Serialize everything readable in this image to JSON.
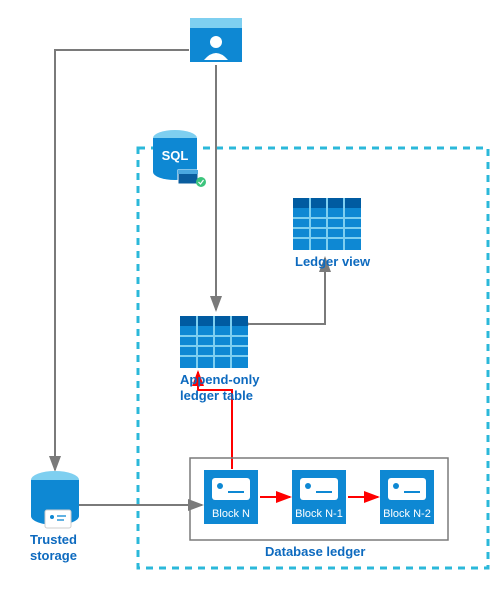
{
  "labels": {
    "sql": "SQL",
    "ledger_view": "Ledger view",
    "append_table": "Append-only\nledger table",
    "trusted_storage": "Trusted\nstorage",
    "database_ledger": "Database ledger",
    "block_n": "Block N",
    "block_n1": "Block N-1",
    "block_n2": "Block N-2"
  },
  "colors": {
    "azure": "#0e88d3",
    "azure_dark": "#005ba1",
    "red": "#ff0000",
    "gray": "#7a7a7a",
    "cyan": "#1bb3d4"
  }
}
